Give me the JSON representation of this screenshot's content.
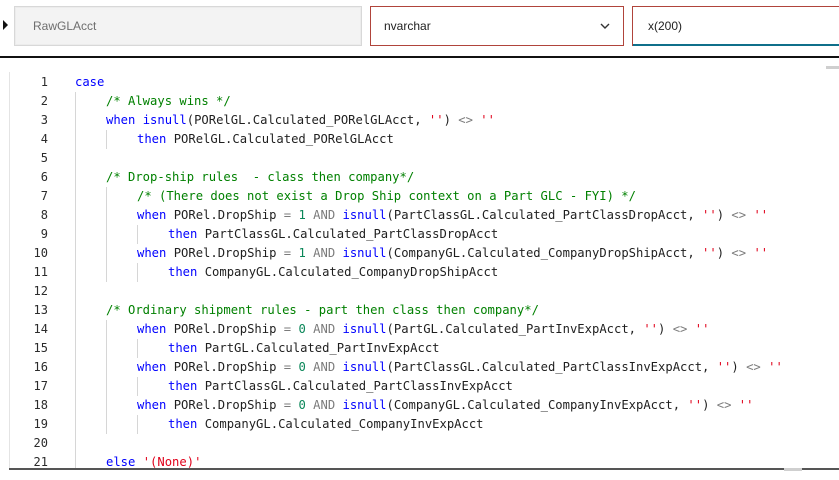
{
  "fields": {
    "name_value": "RawGLAcct",
    "type_value": "nvarchar",
    "length_value": "x(200)"
  },
  "icons": {
    "row_marker": "row-pointer-icon",
    "type_dropdown": "chevron-down-icon"
  },
  "colors": {
    "keyword": "#0000ff",
    "comment": "#008000",
    "string": "#e0001a",
    "operator": "#7b7b7b",
    "number": "#098658",
    "error_border": "#b0443b",
    "focus_underline": "#0f6f8a"
  },
  "editor": {
    "lines": [
      {
        "n": "1",
        "indent": 0,
        "tokens": [
          {
            "t": "case",
            "c": "kw"
          }
        ]
      },
      {
        "n": "2",
        "indent": 1,
        "tokens": [
          {
            "t": "/* Always wins */",
            "c": "cm"
          }
        ]
      },
      {
        "n": "3",
        "indent": 1,
        "tokens": [
          {
            "t": "when",
            "c": "kw"
          },
          {
            "t": " ",
            "c": "pl"
          },
          {
            "t": "isnull",
            "c": "kw"
          },
          {
            "t": "(PORelGL.Calculated_PORelGLAcct, ",
            "c": "pl"
          },
          {
            "t": "''",
            "c": "str"
          },
          {
            "t": ") ",
            "c": "pl"
          },
          {
            "t": "<>",
            "c": "op"
          },
          {
            "t": " ",
            "c": "pl"
          },
          {
            "t": "''",
            "c": "str"
          }
        ]
      },
      {
        "n": "4",
        "indent": 2,
        "tokens": [
          {
            "t": "then",
            "c": "kw"
          },
          {
            "t": " PORelGL.Calculated_PORelGLAcct",
            "c": "pl"
          }
        ]
      },
      {
        "n": "5",
        "indent": 1,
        "tokens": []
      },
      {
        "n": "6",
        "indent": 1,
        "tokens": [
          {
            "t": "/* Drop-ship rules  - class then company*/",
            "c": "cm"
          }
        ]
      },
      {
        "n": "7",
        "indent": 2,
        "tokens": [
          {
            "t": "/* (There does not exist a Drop Ship context on a Part GLC - FYI) */",
            "c": "cm"
          }
        ]
      },
      {
        "n": "8",
        "indent": 2,
        "tokens": [
          {
            "t": "when",
            "c": "kw"
          },
          {
            "t": " PORel.DropShip ",
            "c": "pl"
          },
          {
            "t": "=",
            "c": "op"
          },
          {
            "t": " ",
            "c": "pl"
          },
          {
            "t": "1",
            "c": "num"
          },
          {
            "t": " ",
            "c": "pl"
          },
          {
            "t": "AND",
            "c": "op"
          },
          {
            "t": " ",
            "c": "pl"
          },
          {
            "t": "isnull",
            "c": "kw"
          },
          {
            "t": "(PartClassGL.Calculated_PartClassDropAcct, ",
            "c": "pl"
          },
          {
            "t": "''",
            "c": "str"
          },
          {
            "t": ") ",
            "c": "pl"
          },
          {
            "t": "<>",
            "c": "op"
          },
          {
            "t": " ",
            "c": "pl"
          },
          {
            "t": "''",
            "c": "str"
          }
        ]
      },
      {
        "n": "9",
        "indent": 3,
        "tokens": [
          {
            "t": "then",
            "c": "kw"
          },
          {
            "t": " PartClassGL.Calculated_PartClassDropAcct",
            "c": "pl"
          }
        ]
      },
      {
        "n": "10",
        "indent": 2,
        "tokens": [
          {
            "t": "when",
            "c": "kw"
          },
          {
            "t": " PORel.DropShip ",
            "c": "pl"
          },
          {
            "t": "=",
            "c": "op"
          },
          {
            "t": " ",
            "c": "pl"
          },
          {
            "t": "1",
            "c": "num"
          },
          {
            "t": " ",
            "c": "pl"
          },
          {
            "t": "AND",
            "c": "op"
          },
          {
            "t": " ",
            "c": "pl"
          },
          {
            "t": "isnull",
            "c": "kw"
          },
          {
            "t": "(CompanyGL.Calculated_CompanyDropShipAcct, ",
            "c": "pl"
          },
          {
            "t": "''",
            "c": "str"
          },
          {
            "t": ") ",
            "c": "pl"
          },
          {
            "t": "<>",
            "c": "op"
          },
          {
            "t": " ",
            "c": "pl"
          },
          {
            "t": "''",
            "c": "str"
          }
        ]
      },
      {
        "n": "11",
        "indent": 3,
        "tokens": [
          {
            "t": "then",
            "c": "kw"
          },
          {
            "t": " CompanyGL.Calculated_CompanyDropShipAcct",
            "c": "pl"
          }
        ]
      },
      {
        "n": "12",
        "indent": 1,
        "tokens": []
      },
      {
        "n": "13",
        "indent": 1,
        "tokens": [
          {
            "t": "/* Ordinary shipment rules - part then class then company*/",
            "c": "cm"
          }
        ]
      },
      {
        "n": "14",
        "indent": 2,
        "tokens": [
          {
            "t": "when",
            "c": "kw"
          },
          {
            "t": " PORel.DropShip ",
            "c": "pl"
          },
          {
            "t": "=",
            "c": "op"
          },
          {
            "t": " ",
            "c": "pl"
          },
          {
            "t": "0",
            "c": "num"
          },
          {
            "t": " ",
            "c": "pl"
          },
          {
            "t": "AND",
            "c": "op"
          },
          {
            "t": " ",
            "c": "pl"
          },
          {
            "t": "isnull",
            "c": "kw"
          },
          {
            "t": "(PartGL.Calculated_PartInvExpAcct, ",
            "c": "pl"
          },
          {
            "t": "''",
            "c": "str"
          },
          {
            "t": ") ",
            "c": "pl"
          },
          {
            "t": "<>",
            "c": "op"
          },
          {
            "t": " ",
            "c": "pl"
          },
          {
            "t": "''",
            "c": "str"
          }
        ]
      },
      {
        "n": "15",
        "indent": 3,
        "tokens": [
          {
            "t": "then",
            "c": "kw"
          },
          {
            "t": " PartGL.Calculated_PartInvExpAcct",
            "c": "pl"
          }
        ]
      },
      {
        "n": "16",
        "indent": 2,
        "tokens": [
          {
            "t": "when",
            "c": "kw"
          },
          {
            "t": " PORel.DropShip ",
            "c": "pl"
          },
          {
            "t": "=",
            "c": "op"
          },
          {
            "t": " ",
            "c": "pl"
          },
          {
            "t": "0",
            "c": "num"
          },
          {
            "t": " ",
            "c": "pl"
          },
          {
            "t": "AND",
            "c": "op"
          },
          {
            "t": " ",
            "c": "pl"
          },
          {
            "t": "isnull",
            "c": "kw"
          },
          {
            "t": "(PartClassGL.Calculated_PartClassInvExpAcct, ",
            "c": "pl"
          },
          {
            "t": "''",
            "c": "str"
          },
          {
            "t": ") ",
            "c": "pl"
          },
          {
            "t": "<>",
            "c": "op"
          },
          {
            "t": " ",
            "c": "pl"
          },
          {
            "t": "''",
            "c": "str"
          }
        ]
      },
      {
        "n": "17",
        "indent": 3,
        "tokens": [
          {
            "t": "then",
            "c": "kw"
          },
          {
            "t": " PartClassGL.Calculated_PartClassInvExpAcct",
            "c": "pl"
          }
        ]
      },
      {
        "n": "18",
        "indent": 2,
        "tokens": [
          {
            "t": "when",
            "c": "kw"
          },
          {
            "t": " PORel.DropShip ",
            "c": "pl"
          },
          {
            "t": "=",
            "c": "op"
          },
          {
            "t": " ",
            "c": "pl"
          },
          {
            "t": "0",
            "c": "num"
          },
          {
            "t": " ",
            "c": "pl"
          },
          {
            "t": "AND",
            "c": "op"
          },
          {
            "t": " ",
            "c": "pl"
          },
          {
            "t": "isnull",
            "c": "kw"
          },
          {
            "t": "(CompanyGL.Calculated_CompanyInvExpAcct, ",
            "c": "pl"
          },
          {
            "t": "''",
            "c": "str"
          },
          {
            "t": ") ",
            "c": "pl"
          },
          {
            "t": "<>",
            "c": "op"
          },
          {
            "t": " ",
            "c": "pl"
          },
          {
            "t": "''",
            "c": "str"
          }
        ]
      },
      {
        "n": "19",
        "indent": 3,
        "tokens": [
          {
            "t": "then",
            "c": "kw"
          },
          {
            "t": " CompanyGL.Calculated_CompanyInvExpAcct",
            "c": "pl"
          }
        ]
      },
      {
        "n": "20",
        "indent": 1,
        "tokens": []
      },
      {
        "n": "21",
        "indent": 1,
        "tokens": [
          {
            "t": "else",
            "c": "kw"
          },
          {
            "t": " ",
            "c": "pl"
          },
          {
            "t": "'(None)'",
            "c": "str"
          }
        ]
      }
    ]
  }
}
